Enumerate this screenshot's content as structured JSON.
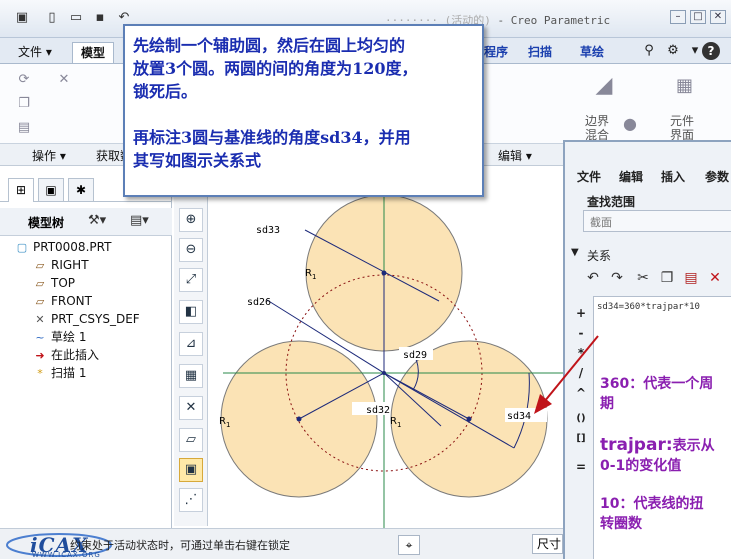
{
  "window": {
    "title": "- Creo Parametric",
    "title_prefix_blurred": "········ (活动的)"
  },
  "tabs": [
    {
      "label": "文件 ▾"
    },
    {
      "label": "模型"
    },
    {
      "label": "程序"
    },
    {
      "label": "扫描"
    },
    {
      "label": "草绘"
    }
  ],
  "ribbon": {
    "boundary_blend": "边界\n混合",
    "feature_interface": "元件\n界面"
  },
  "groups": {
    "operations": "操作 ▾",
    "get_data": "获取数",
    "edit": "编辑 ▾"
  },
  "model_tree": {
    "title": "模型树",
    "items": [
      {
        "icon": "▢",
        "label": "PRT0008.PRT"
      },
      {
        "icon": "▱",
        "label": "RIGHT"
      },
      {
        "icon": "▱",
        "label": "TOP"
      },
      {
        "icon": "▱",
        "label": "FRONT"
      },
      {
        "icon": "✕",
        "label": "PRT_CSYS_DEF"
      },
      {
        "icon": "~",
        "label": "草绘 1"
      },
      {
        "icon": "➜",
        "label": "在此插入"
      },
      {
        "icon": "*",
        "label": "扫描 1"
      }
    ]
  },
  "sketch": {
    "dims": [
      "sd33",
      "sd26",
      "sd29",
      "sd32",
      "sd34"
    ],
    "radius_label": "R",
    "radius_sub": "1"
  },
  "callout": {
    "lines": [
      "先绘制一个辅助圆，然后在圆上均匀的",
      "放置3个圆。两圆的间的角度为120度，",
      "锁死后。",
      "",
      "再标注3圆与基准线的角度sd34，并用",
      "其写如图示关系式"
    ]
  },
  "relations_dialog": {
    "menu": [
      "文件",
      "编辑",
      "插入",
      "参数"
    ],
    "scope_title": "查找范围",
    "scope_value": "截面",
    "relations_title": "关系",
    "relation_text": "sd34=360*trajpar*10",
    "operators": [
      "+",
      "-",
      "*",
      "/",
      "^",
      "()",
      "[]",
      "="
    ]
  },
  "notes": {
    "n360_a": "360：代表一个周",
    "n360_b": "期",
    "trajpar_a_lg": "trajpar:",
    "trajpar_a_sm": "表示从",
    "trajpar_b": "0-1的变化值",
    "n10_a": "10：代表线的扭",
    "n10_b": "转圈数"
  },
  "status": {
    "message": "约束处于活动状态时，可通过单击右键在锁定",
    "select": "尺寸",
    "logo": "iCAX",
    "logo_url": "WWW.ICAX.ORG"
  },
  "colors": {
    "circle_fill": "#fbe3b5",
    "circle_stroke": "#7a7a7a",
    "callout_text": "#1a2db0",
    "note_text": "#8a1fb0",
    "arrow": "#c0141a"
  }
}
